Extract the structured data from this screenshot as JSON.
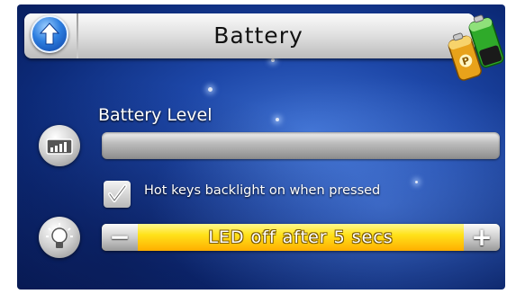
{
  "header": {
    "title": "Battery",
    "back_icon": "up-arrow-icon",
    "logo_icon": "battery-power-icon"
  },
  "battery_level": {
    "label": "Battery Level",
    "icon": "signal-bars-icon",
    "level": 0
  },
  "hotkeys": {
    "label": "Hot keys backlight on when pressed",
    "checked": true
  },
  "led": {
    "icon": "light-bulb-icon",
    "value_text": "LED off after 5 secs",
    "minus_label": "−",
    "plus_label": "+"
  },
  "colors": {
    "background": "#1d47a8",
    "slider_yellow": "#ffe21a",
    "slider_orange": "#ffae00"
  }
}
